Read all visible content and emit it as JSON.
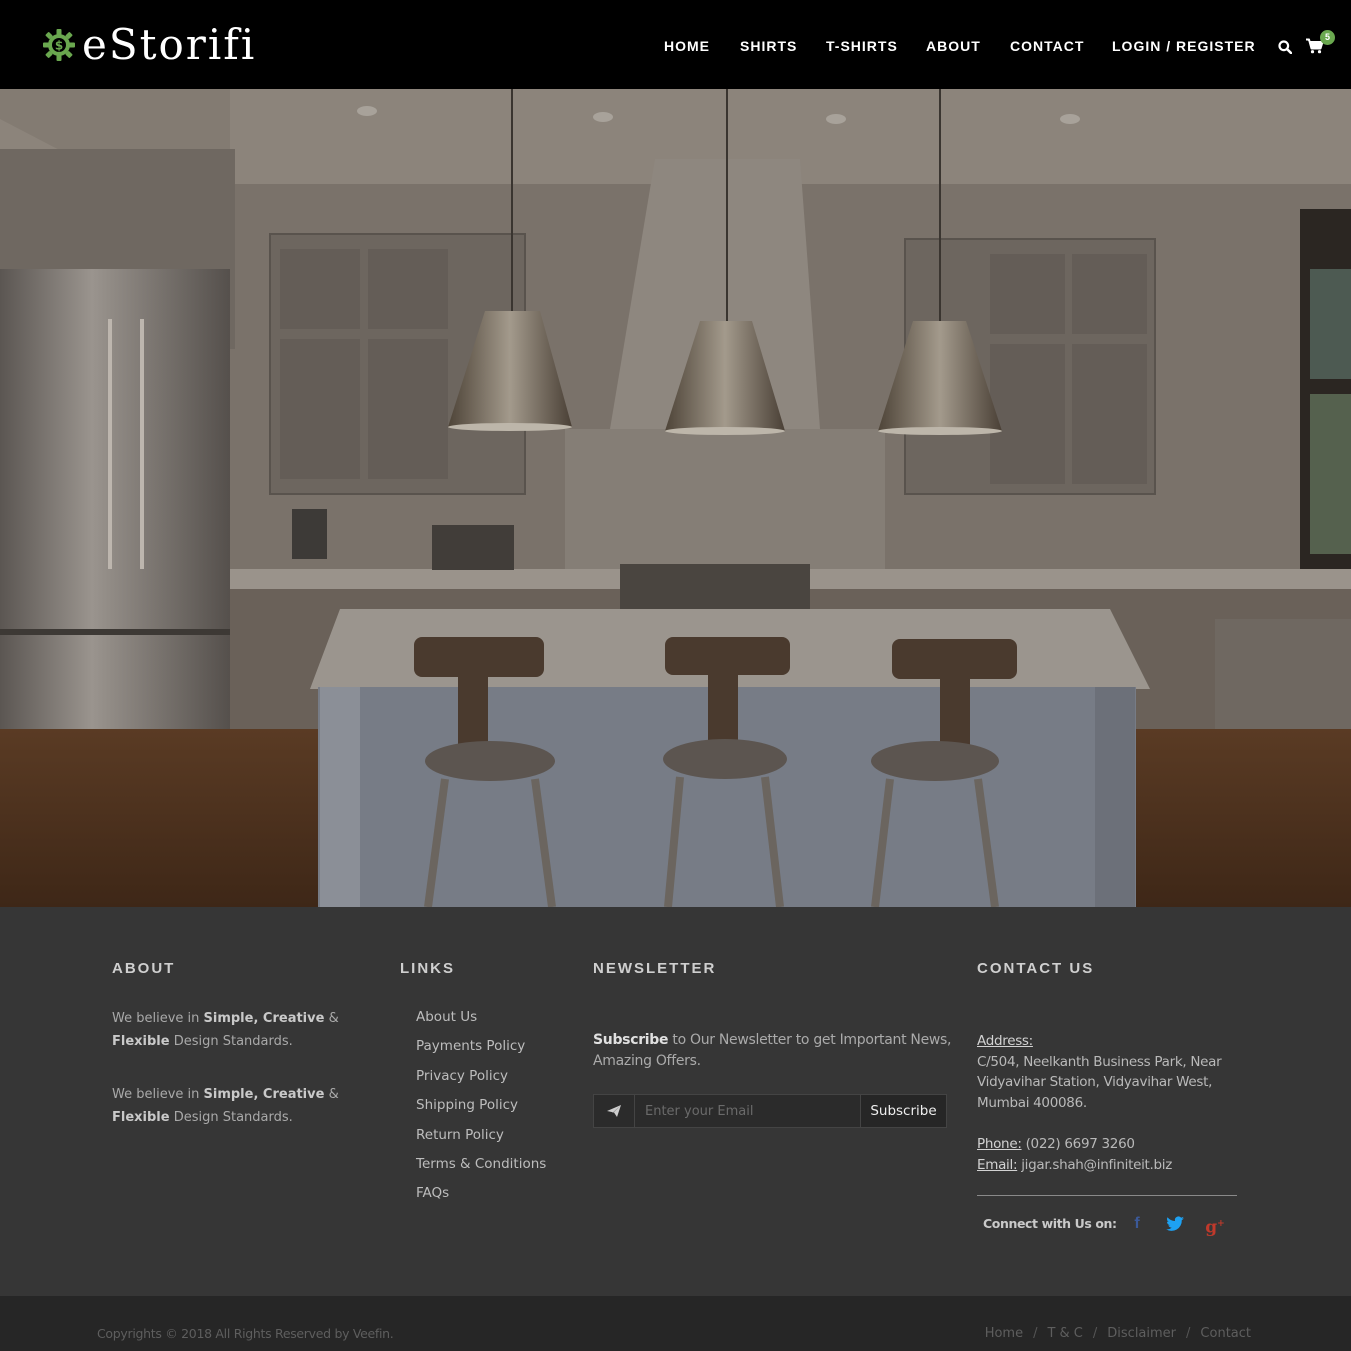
{
  "header": {
    "logo_text": "eStorifi",
    "nav": [
      {
        "label": "HOME",
        "name": "nav-home"
      },
      {
        "label": "SHIRTS",
        "name": "nav-shirts"
      },
      {
        "label": "T-SHIRTS",
        "name": "nav-t-shirts"
      },
      {
        "label": "ABOUT",
        "name": "nav-about"
      },
      {
        "label": "CONTACT",
        "name": "nav-contact"
      },
      {
        "label": "LOGIN / REGISTER",
        "name": "nav-login-register"
      }
    ],
    "search_icon": "search-icon",
    "cart_icon": "shopping-cart-icon",
    "cart_count": "5",
    "accent_color": "#6aa84f"
  },
  "footer": {
    "about": {
      "title": "ABOUT",
      "para1": {
        "pre": "We believe in ",
        "b1": "Simple, Creative",
        "amp": " & ",
        "b2": "Flexible",
        "post": " Design Standards."
      },
      "para2": {
        "pre": "We believe in ",
        "b1": "Simple, Creative",
        "amp": " & ",
        "b2": "Flexible",
        "post": " Design Standards."
      }
    },
    "links": {
      "title": "LINKS",
      "items": [
        "About Us",
        "Payments Policy",
        "Privacy Policy",
        "Shipping Policy",
        "Return Policy",
        "Terms & Conditions",
        "FAQs"
      ]
    },
    "newsletter": {
      "title": "NEWSLETTER",
      "bold": "Subscribe",
      "text": " to Our Newsletter to get Important News, Amazing Offers.",
      "placeholder": "Enter your Email",
      "button": "Subscribe",
      "icon": "paper-plane-icon"
    },
    "contact": {
      "title": "CONTACT US",
      "address_label": "Address:",
      "address": "C/504, Neelkanth Business Park, Near Vidyavihar Station, Vidyavihar West, Mumbai 400086.",
      "phone_label": "Phone:",
      "phone": " (022) 6697 3260",
      "email_label": "Email:",
      "email": " jigar.shah@infiniteit.biz",
      "connect": "Connect with Us on:",
      "social": [
        {
          "name": "facebook-icon",
          "color": "#3b5998"
        },
        {
          "name": "twitter-icon",
          "color": "#1da1f2"
        },
        {
          "name": "google-plus-icon",
          "color": "#c0392b"
        }
      ]
    }
  },
  "bottom": {
    "copyright": "Copyrights © 2018 All Rights Reserved by Veefin.",
    "links": [
      "Home",
      "T & C",
      "Disclaimer",
      "Contact"
    ],
    "separator": "/"
  }
}
